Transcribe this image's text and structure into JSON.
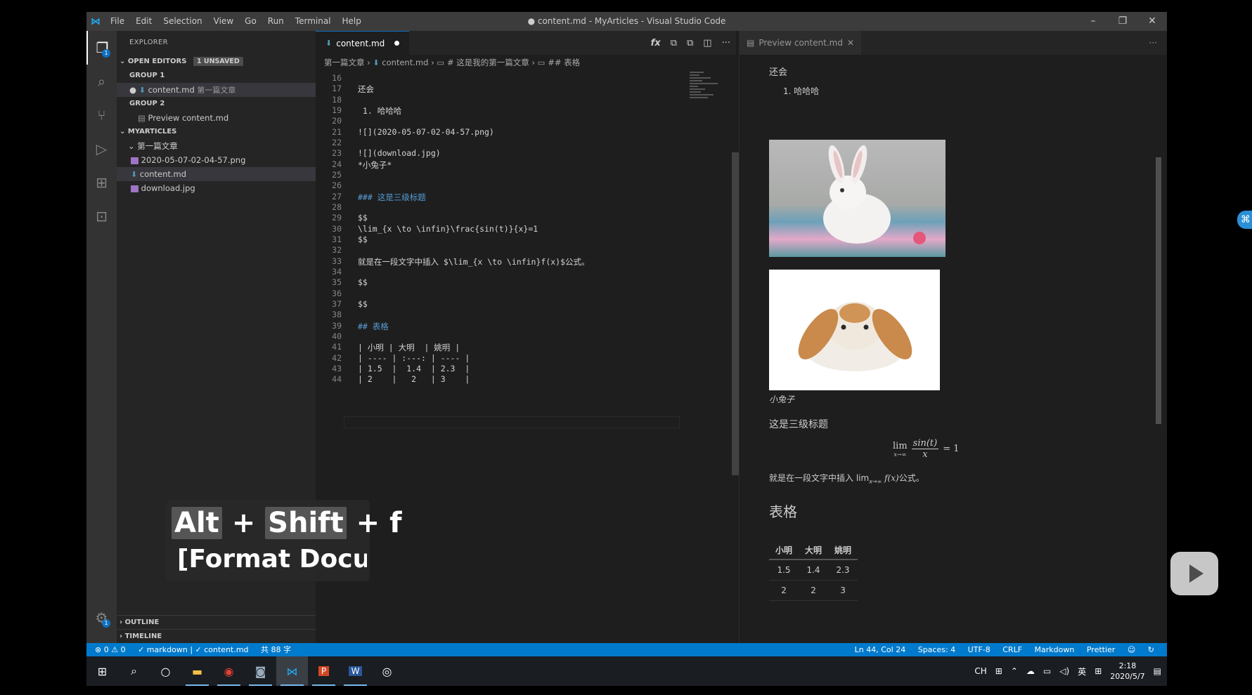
{
  "window": {
    "title": "● content.md - MyArticles - Visual Studio Code",
    "menu": [
      "File",
      "Edit",
      "Selection",
      "View",
      "Go",
      "Run",
      "Terminal",
      "Help"
    ]
  },
  "sidebar": {
    "title": "EXPLORER",
    "open_editors": "OPEN EDITORS",
    "unsaved": "1 UNSAVED",
    "group1": "GROUP 1",
    "group1_item": "content.md",
    "group1_item_path": "第一篇文章",
    "group2": "GROUP 2",
    "group2_item": "Preview content.md",
    "project": "MYARTICLES",
    "folder": "第一篇文章",
    "files": [
      "2020-05-07-02-04-57.png",
      "content.md",
      "download.jpg"
    ],
    "outline": "OUTLINE",
    "timeline": "TIMELINE"
  },
  "editor": {
    "tab": "content.md",
    "breadcrumb": [
      "第一篇文章",
      "content.md",
      "# 这是我的第一篇文章",
      "## 表格"
    ],
    "lines": [
      {
        "n": "16",
        "t": ""
      },
      {
        "n": "17",
        "t": "还会"
      },
      {
        "n": "18",
        "t": ""
      },
      {
        "n": "19",
        "t": " 1. 哈哈哈"
      },
      {
        "n": "20",
        "t": ""
      },
      {
        "n": "21",
        "t": "![](2020-05-07-02-04-57.png)"
      },
      {
        "n": "22",
        "t": ""
      },
      {
        "n": "23",
        "t": "![](download.jpg)"
      },
      {
        "n": "24",
        "t": "*小兔子*"
      },
      {
        "n": "25",
        "t": ""
      },
      {
        "n": "26",
        "t": ""
      },
      {
        "n": "27",
        "t": "### 这是三级标题"
      },
      {
        "n": "28",
        "t": ""
      },
      {
        "n": "29",
        "t": "$$"
      },
      {
        "n": "30",
        "t": "\\lim_{x \\to \\infin}\\frac{sin(t)}{x}=1"
      },
      {
        "n": "31",
        "t": "$$"
      },
      {
        "n": "32",
        "t": ""
      },
      {
        "n": "33",
        "t": "就是在一段文字中插入 $\\lim_{x \\to \\infin}f(x)$公式。"
      },
      {
        "n": "34",
        "t": ""
      },
      {
        "n": "35",
        "t": "$$"
      },
      {
        "n": "36",
        "t": ""
      },
      {
        "n": "37",
        "t": "$$"
      },
      {
        "n": "38",
        "t": ""
      },
      {
        "n": "39",
        "t": "## 表格"
      },
      {
        "n": "40",
        "t": ""
      },
      {
        "n": "41",
        "t": "| 小明 | 大明  | 姚明 |"
      },
      {
        "n": "42",
        "t": "| ---- | :---: | ---- |"
      },
      {
        "n": "43",
        "t": "| 1.5  |  1.4  | 2.3  |"
      },
      {
        "n": "44",
        "t": "| 2    |   2   | 3    |"
      }
    ]
  },
  "keycast": {
    "alt": "Alt",
    "shift": "Shift",
    "f": "f",
    "command": "[Format Docume"
  },
  "preview": {
    "tab": "Preview content.md",
    "p1": "还会",
    "li1": "1. 哈哈哈",
    "caption": "小兔子",
    "h3": "这是三级标题",
    "math_lim": "lim",
    "math_sub": "x→∞",
    "math_num": "sin(t)",
    "math_den": "x",
    "math_eq": "= 1",
    "inline_text": "就是在一段文字中插入 lim",
    "inline_sub": "x→∞",
    "inline_fx": " f(x)",
    "inline_tail": "公式。",
    "h2": "表格",
    "table": {
      "headers": [
        "小明",
        "大明",
        "姚明"
      ],
      "rows": [
        [
          "1.5",
          "1.4",
          "2.3"
        ],
        [
          "2",
          "2",
          "3"
        ]
      ]
    }
  },
  "status": {
    "errors": "⊗ 0 ⚠ 0",
    "lint": "✓ markdown | ✓ content.md",
    "words": "共 88 字",
    "position": "Ln 44, Col 24",
    "spaces": "Spaces: 4",
    "encoding": "UTF-8",
    "eol": "CRLF",
    "language": "Markdown",
    "formatter": "Prettier"
  },
  "taskbar": {
    "ime": "CH",
    "lang": "英",
    "time": "2:18",
    "date": "2020/5/7"
  },
  "colors": {
    "accent": "#007acc",
    "heading": "#569cd6"
  }
}
